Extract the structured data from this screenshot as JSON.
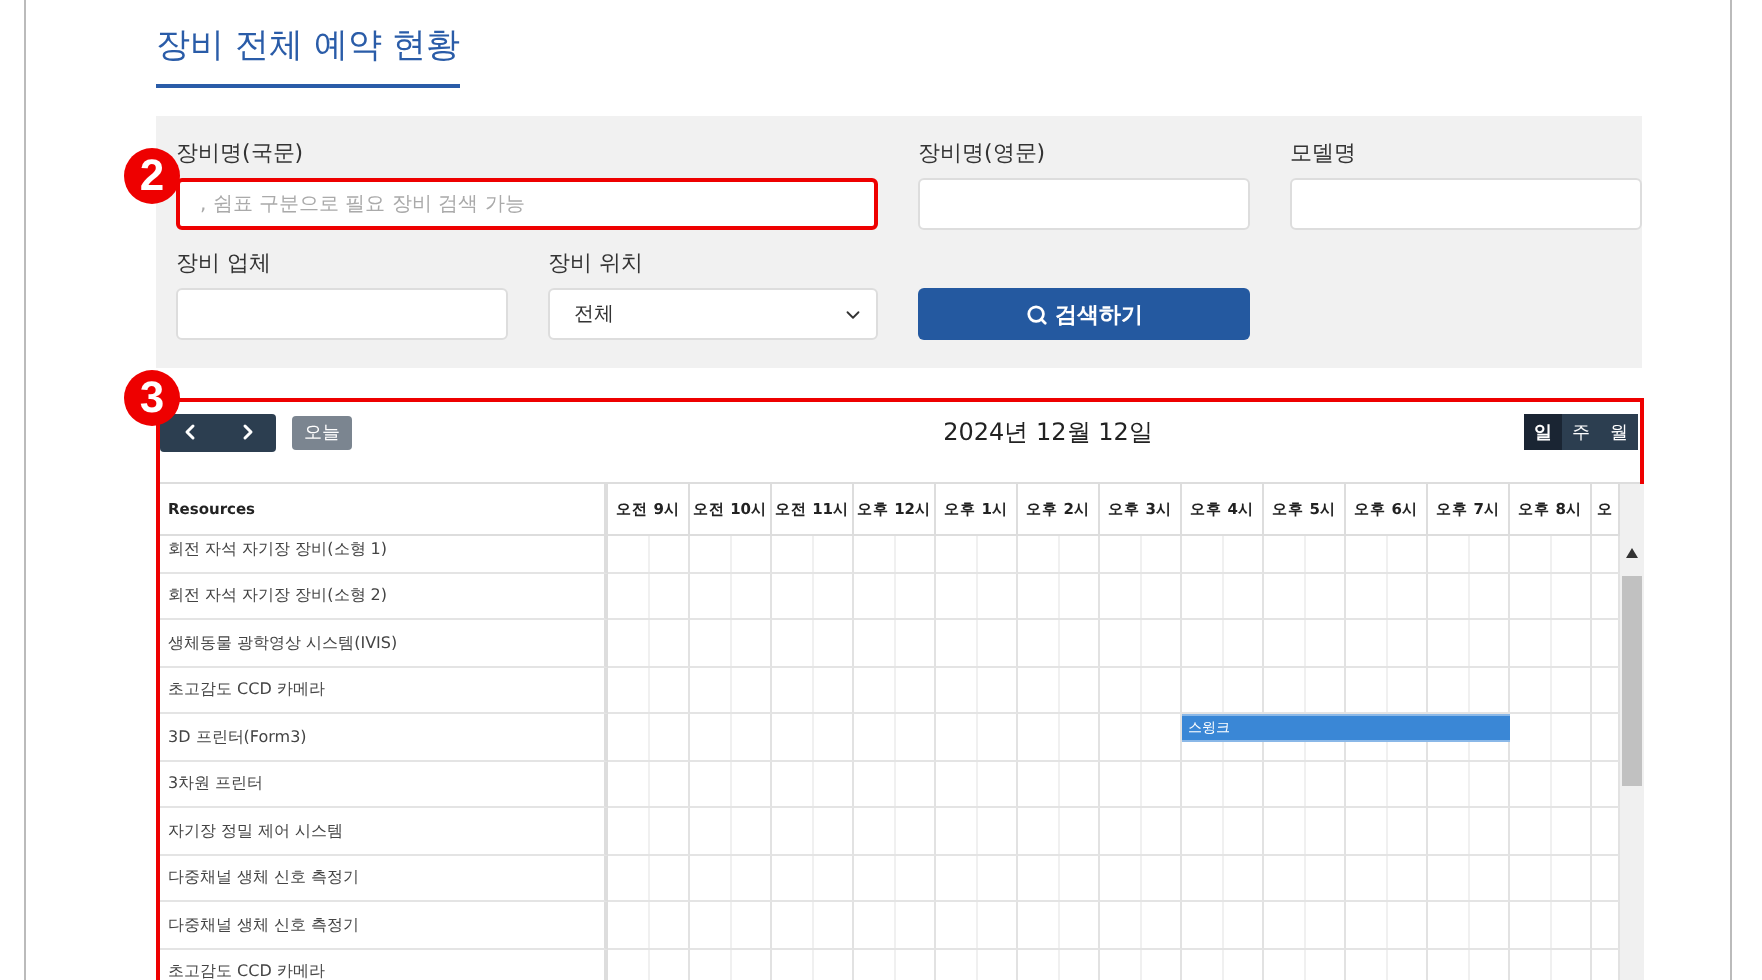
{
  "page_title": "장비 전체 예약 현황",
  "search_form": {
    "fields": [
      {
        "kind": "text",
        "label": "장비명(국문)",
        "placeholder": ", 쉼표 구분으로 필요 장비 검색 가능",
        "highlighted": true,
        "marker": "2"
      },
      {
        "kind": "text",
        "label": "장비명(영문)",
        "highlighted": false
      },
      {
        "kind": "text",
        "label": "모델명",
        "highlighted": false
      },
      {
        "kind": "text",
        "label": "장비 업체",
        "highlighted": false
      },
      {
        "kind": "select",
        "label": "장비 위치",
        "value": "전체",
        "highlighted": false
      }
    ],
    "search_button": "검색하기"
  },
  "calendar": {
    "highlighted": true,
    "marker": "3",
    "today_button": "오늘",
    "date": "2024년 12월 12일",
    "views": [
      {
        "label": "일",
        "selected": true
      },
      {
        "label": "주",
        "selected": false
      },
      {
        "label": "월",
        "selected": false
      }
    ],
    "resource_header": "Resources",
    "hours": [
      "오전 9시",
      "오전 10시",
      "오전 11시",
      "오후 12시",
      "오후 1시",
      "오후 2시",
      "오후 3시",
      "오후 4시",
      "오후 5시",
      "오후 6시",
      "오후 7시",
      "오후 8시",
      "오"
    ],
    "resources": [
      {
        "name": "회전 자석 자기장 장비(소형 1)"
      },
      {
        "name": "회전 자석 자기장 장비(소형 2)"
      },
      {
        "name": "생체동물 광학영상 시스템(IVIS)"
      },
      {
        "name": "초고감도 CCD 카메라"
      },
      {
        "name": "3D 프린터(Form3)",
        "event": "스윙크",
        "booked": [
          false,
          false,
          false,
          false,
          false,
          false,
          false,
          true,
          true,
          true,
          true,
          false,
          false
        ]
      },
      {
        "name": "3차원 프린터"
      },
      {
        "name": "자기장 정밀 제어 시스템"
      },
      {
        "name": "다중채널 생체 신호 측정기"
      },
      {
        "name": "다중채널 생체 신호 측정기"
      },
      {
        "name": "초고감도 CCD 카메라"
      }
    ]
  }
}
